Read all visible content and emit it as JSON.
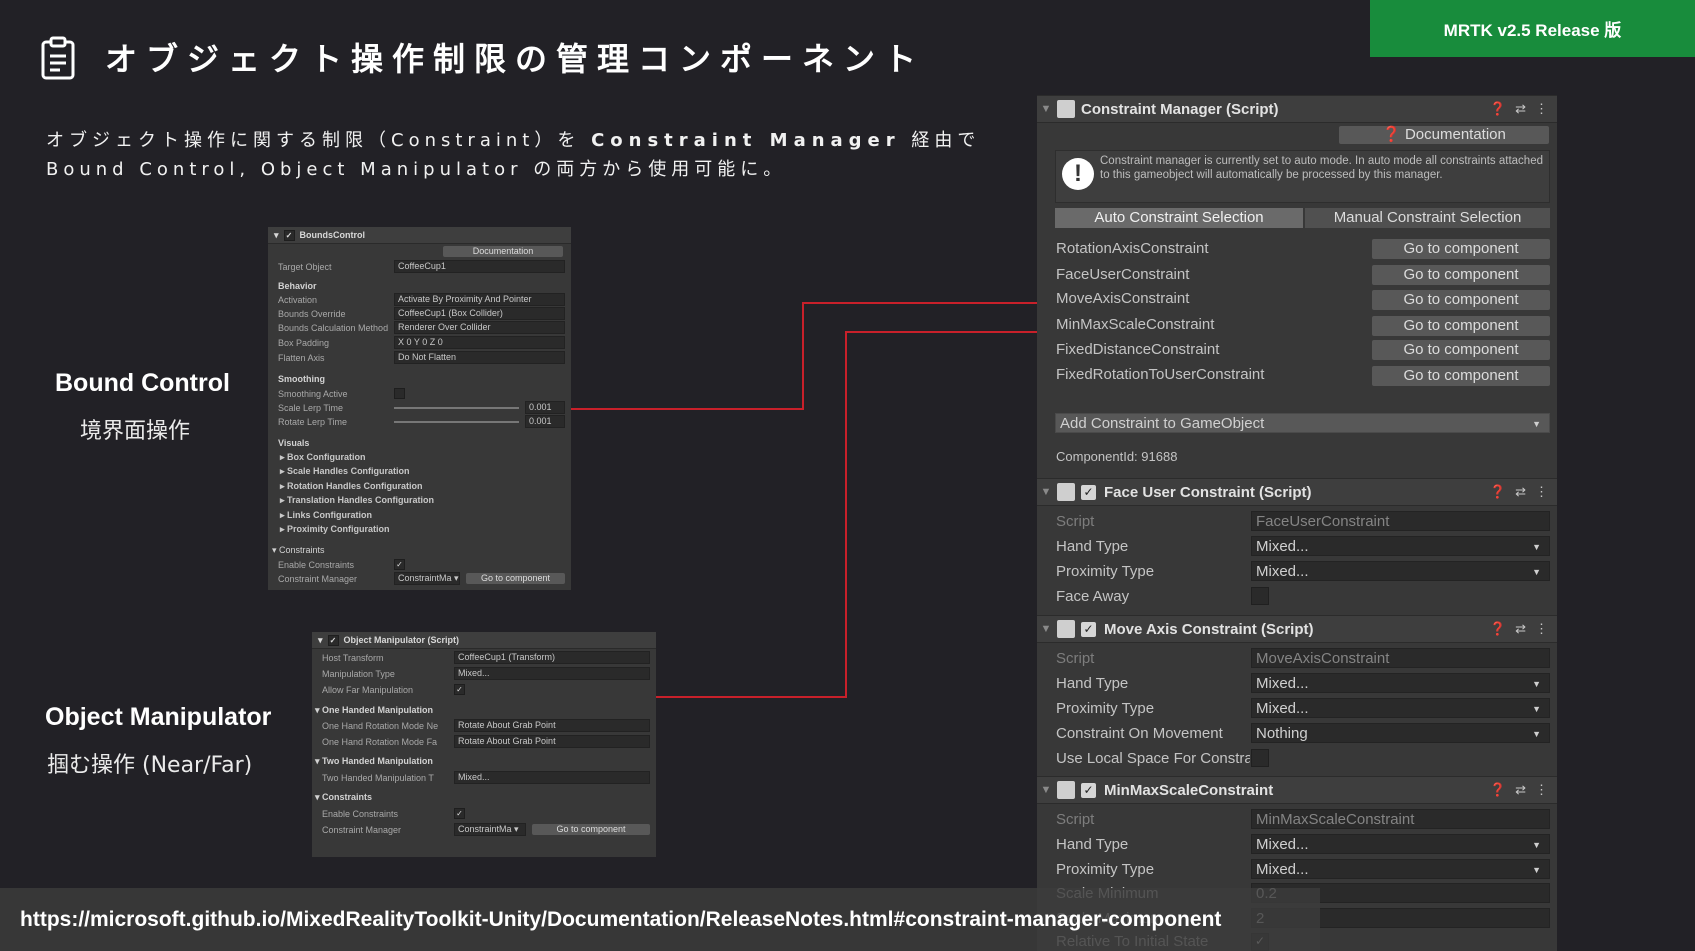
{
  "badge": "MRTK v2.5 Release 版",
  "title": "オブジェクト操作制限の管理コンポーネント",
  "icons": {
    "clipboard": "clipboard-icon"
  },
  "description": {
    "line1_prefix": "オブジェクト操作に関する制限（Constraint）を",
    "line1_bold": "Constraint Manager",
    "line1_suffix": "経由で",
    "line2": "Bound Control, Object Manipulator の両方から使用可能に。"
  },
  "labels": {
    "bound_en": "Bound Control",
    "bound_ja": "境界面操作",
    "manip_en": "Object Manipulator",
    "manip_ja": "掴む操作 (Near/Far)"
  },
  "bounds_control": {
    "header": "BoundsControl",
    "documentation": "Documentation",
    "rows": [
      {
        "key": "Target Object",
        "value": "CoffeeCup1"
      },
      {
        "key": "Activation",
        "value": "Activate By Proximity And Pointer"
      },
      {
        "key": "Bounds Override",
        "value": "CoffeeCup1 (Box Collider)"
      },
      {
        "key": "Bounds Calculation Method",
        "value": "Renderer Over Collider"
      },
      {
        "key": "Box Padding",
        "value": "X 0        Y 0        Z 0"
      },
      {
        "key": "Flatten Axis",
        "value": "Do Not Flatten"
      },
      {
        "key": "Smoothing Active",
        "value": ""
      },
      {
        "key": "Scale Lerp Time",
        "value": "0.001"
      },
      {
        "key": "Rotate Lerp Time",
        "value": "0.001"
      },
      {
        "key": "Enable Constraints",
        "value": "✓"
      },
      {
        "key": "Constraint Manager",
        "value": "ConstraintMa ▾"
      }
    ],
    "sections": [
      "Behavior",
      "Smoothing",
      "Visuals",
      "Constraints"
    ],
    "folds": [
      "Box Configuration",
      "Scale Handles Configuration",
      "Rotation Handles Configuration",
      "Translation Handles Configuration",
      "Links Configuration",
      "Proximity Configuration"
    ],
    "goto": "Go to component"
  },
  "object_manipulator": {
    "header": "Object Manipulator (Script)",
    "rows": [
      {
        "key": "Host Transform",
        "value": "CoffeeCup1 (Transform)"
      },
      {
        "key": "Manipulation Type",
        "value": "Mixed..."
      },
      {
        "key": "Allow Far Manipulation",
        "value": "✓"
      },
      {
        "key": "One Hand Rotation Mode Ne",
        "value": "Rotate About Grab Point"
      },
      {
        "key": "One Hand Rotation Mode Fa",
        "value": "Rotate About Grab Point"
      },
      {
        "key": "Two Handed Manipulation T",
        "value": "Mixed..."
      },
      {
        "key": "Enable Constraints",
        "value": "✓"
      },
      {
        "key": "Constraint Manager",
        "value": "ConstraintMa ▾"
      }
    ],
    "sections": [
      "One Handed Manipulation",
      "Two Handed Manipulation",
      "Constraints"
    ],
    "goto": "Go to component"
  },
  "inspector": {
    "cm_header": "Constraint Manager (Script)",
    "documentation": "Documentation",
    "help": "Constraint manager is currently set to auto mode. In auto mode all constraints attached to this gameobject will automatically be processed by this manager.",
    "tab_auto": "Auto Constraint Selection",
    "tab_manual": "Manual Constraint Selection",
    "constraints": [
      "RotationAxisConstraint",
      "FaceUserConstraint",
      "MoveAxisConstraint",
      "MinMaxScaleConstraint",
      "FixedDistanceConstraint",
      "FixedRotationToUserConstraint"
    ],
    "goto": "Go to component",
    "add": "Add Constraint to GameObject",
    "component_id": "ComponentId: 91688",
    "face_header": "Face User Constraint (Script)",
    "face_rows": [
      {
        "key": "Script",
        "value": "FaceUserConstraint"
      },
      {
        "key": "Hand Type",
        "value": "Mixed..."
      },
      {
        "key": "Proximity Type",
        "value": "Mixed..."
      },
      {
        "key": "Face Away",
        "value": ""
      }
    ],
    "move_header": "Move Axis Constraint (Script)",
    "move_rows": [
      {
        "key": "Script",
        "value": "MoveAxisConstraint"
      },
      {
        "key": "Hand Type",
        "value": "Mixed..."
      },
      {
        "key": "Proximity Type",
        "value": "Mixed..."
      },
      {
        "key": "Constraint On Movement",
        "value": "Nothing"
      },
      {
        "key": "Use Local Space For Constra",
        "value": ""
      }
    ],
    "minmax_header": "MinMaxScaleConstraint",
    "minmax_rows": [
      {
        "key": "Script",
        "value": "MinMaxScaleConstraint"
      },
      {
        "key": "Hand Type",
        "value": "Mixed..."
      },
      {
        "key": "Proximity Type",
        "value": "Mixed..."
      },
      {
        "key": "Scale Minimum",
        "value": "0.2"
      },
      {
        "key": "Scale Maximum",
        "value": "2"
      },
      {
        "key": "Relative To Initial State",
        "value": "✓"
      }
    ]
  },
  "url": "https://microsoft.github.io/MixedRealityToolkit-Unity/Documentation/ReleaseNotes.html#constraint-manager-component",
  "colors": {
    "background": "#222126",
    "badge": "#188c3c",
    "connector": "#c8202a"
  }
}
